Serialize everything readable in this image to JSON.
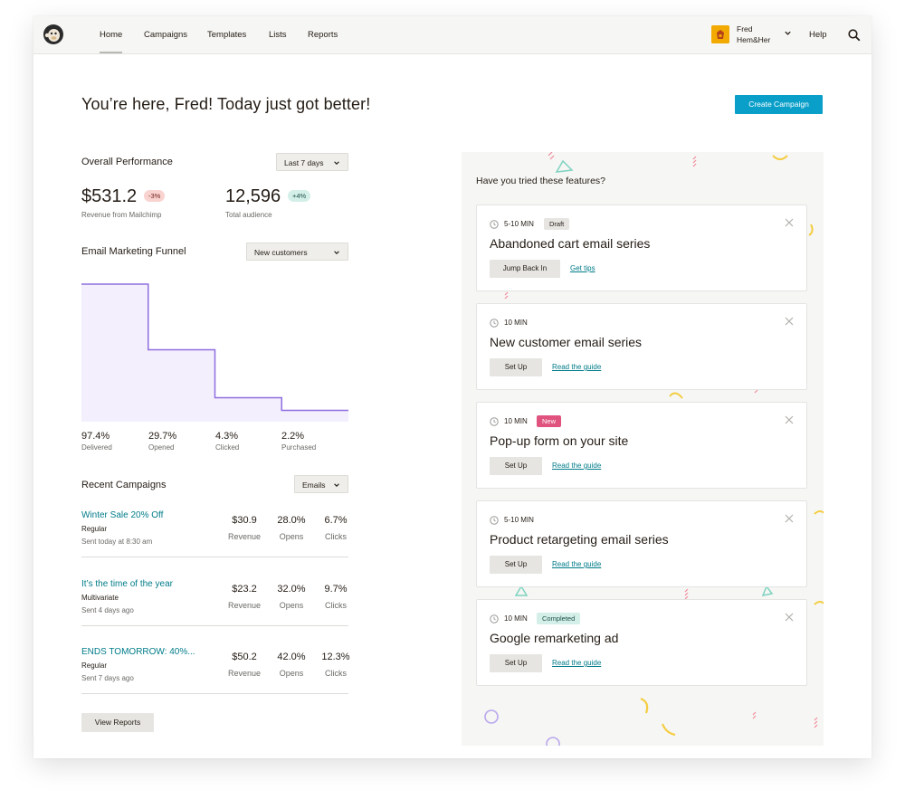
{
  "nav": {
    "items": [
      {
        "label": "Home",
        "active": true
      },
      {
        "label": "Campaigns"
      },
      {
        "label": "Templates"
      },
      {
        "label": "Lists"
      },
      {
        "label": "Reports"
      }
    ],
    "account": {
      "name": "Fred",
      "org": "Hem&Her"
    },
    "help_label": "Help",
    "icons": {
      "logo": "mailchimp-logo-icon",
      "search": "search-icon",
      "chevron": "chevron-down-icon"
    }
  },
  "header": {
    "headline": "You’re here, Fred! Today just got better!",
    "create_button": "Create Campaign"
  },
  "performance": {
    "title": "Overall Performance",
    "range_select": "Last 7 days",
    "revenue": {
      "value": "$531.2",
      "change": "-3%",
      "label": "Revenue from Mailchimp"
    },
    "audience": {
      "value": "12,596",
      "change": "+4%",
      "label": "Total audience"
    }
  },
  "funnel": {
    "title": "Email Marketing Funnel",
    "segment_select": "New customers",
    "steps": [
      {
        "value": "97.4%",
        "label": "Delivered",
        "level": 0.974
      },
      {
        "value": "29.7%",
        "label": "Opened",
        "level": 0.51
      },
      {
        "value": "4.3%",
        "label": "Clicked",
        "level": 0.17
      },
      {
        "value": "2.2%",
        "label": "Purchased",
        "level": 0.08
      }
    ]
  },
  "recent": {
    "title": "Recent Campaigns",
    "type_select": "Emails",
    "campaigns": [
      {
        "title": "Winter Sale 20% Off",
        "type": "Regular",
        "sent": "Sent today at 8:30 am",
        "revenue": "$30.9",
        "opens": "28.0%",
        "clicks": "6.7%"
      },
      {
        "title": "It’s the time of the year",
        "type": "Multivariate",
        "sent": "Sent 4 days ago",
        "revenue": "$23.2",
        "opens": "32.0%",
        "clicks": "9.7%"
      },
      {
        "title": "ENDS TOMORROW: 40%...",
        "type": "Regular",
        "sent": "Sent 7 days ago",
        "revenue": "$50.2",
        "opens": "42.0%",
        "clicks": "12.3%"
      }
    ],
    "labels": {
      "revenue": "Revenue",
      "opens": "Opens",
      "clicks": "Clicks"
    },
    "view_reports": "View Reports"
  },
  "features": {
    "heading": "Have you tried these features?",
    "cards": [
      {
        "time": "5-10 MIN",
        "badge": "Draft",
        "title": "Abandoned cart email series",
        "button": "Jump Back In",
        "link": "Get tips"
      },
      {
        "time": "10 MIN",
        "badge": "",
        "title": "New customer email series",
        "button": "Set Up",
        "link": "Read the guide"
      },
      {
        "time": "10 MIN",
        "badge": "New",
        "title": "Pop-up form on your site",
        "button": "Set Up",
        "link": "Read the guide"
      },
      {
        "time": "5-10 MIN",
        "badge": "",
        "title": "Product retargeting email series",
        "button": "Set Up",
        "link": "Read the guide"
      },
      {
        "time": "10 MIN",
        "badge": "Completed",
        "title": "Google remarketing ad",
        "button": "Set Up",
        "link": "Read the guide"
      }
    ]
  },
  "colors": {
    "accent": "#0a9fc9",
    "link": "#007c89",
    "funnel_line": "#8e6ee0",
    "funnel_fill": "#f3effc"
  }
}
